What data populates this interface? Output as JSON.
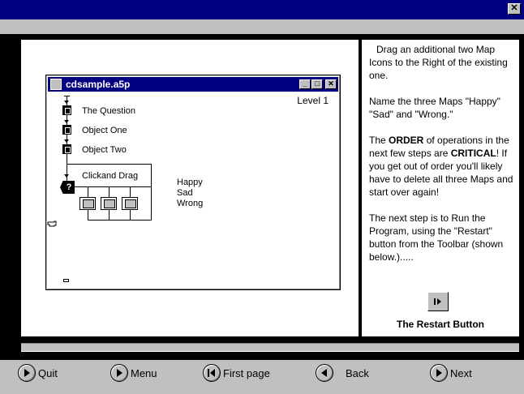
{
  "window": {
    "close_glyph": "✕"
  },
  "inner_window": {
    "title": "cdsample.a5p",
    "min_glyph": "_",
    "max_glyph": "□",
    "close_glyph": "✕",
    "level": "Level 1"
  },
  "flow": {
    "items": [
      {
        "label": "The Question"
      },
      {
        "label": "Object One"
      },
      {
        "label": "Object Two"
      }
    ],
    "decision_label": "Clickand Drag",
    "decision_glyph": "?",
    "outcomes": [
      "Happy",
      "Sad",
      "Wrong"
    ]
  },
  "instructions": {
    "p1": "Drag an additional two Map Icons to the Right of the existing one.",
    "p2": "Name the three Maps \"Happy\" \"Sad\" and \"Wrong.\"",
    "p3_a": "The ",
    "p3_b": "ORDER",
    "p3_c": " of operations in the next few steps are ",
    "p3_d": "CRITICAL",
    "p3_e": "!  If you get out of order you'll likely have to delete all three Maps and start over again!",
    "p4": "The next step is to Run the Program, using the \"Restart\" button from the Toolbar (shown below.).....",
    "restart_caption": "The Restart Button"
  },
  "nav": {
    "quit": "Quit",
    "menu": "Menu",
    "first": "First page",
    "back": "Back",
    "next": "Next"
  },
  "icons": {
    "close": "close-icon",
    "pointing_hand": "pointing-hand-icon",
    "restart": "restart-icon",
    "arrow_right": "arrow-right-icon",
    "arrow_left": "arrow-left-icon",
    "first_page": "first-page-icon"
  },
  "colors": {
    "title_bar": "#000080",
    "panel_bg": "#c0c0c0",
    "stage_bg": "#000000"
  }
}
